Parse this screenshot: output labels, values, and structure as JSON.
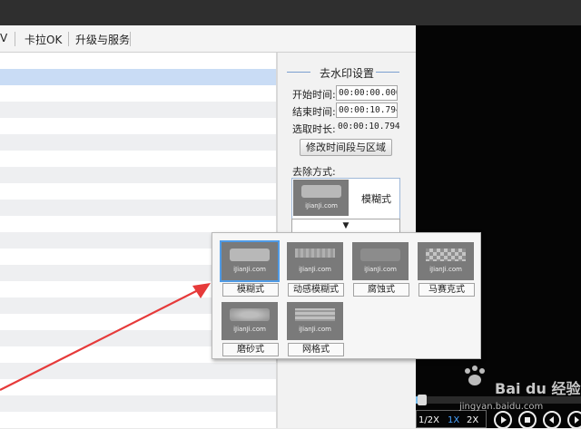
{
  "menu": {
    "items": [
      "V",
      "卡拉OK",
      "升级与服务"
    ]
  },
  "panel": {
    "title": "去水印设置",
    "start_label": "开始时间:",
    "start_value": "00:00:00.000",
    "end_label": "结束时间:",
    "end_value": "00:00:10.794",
    "duration_label": "选取时长:",
    "duration_value": "00:00:10.794",
    "modify_button": "修改时间段与区域",
    "method_label": "去除方式:",
    "selected_method": "模糊式",
    "dropdown_symbol": "▼"
  },
  "popup": {
    "watermark_text": "iJianJi.com",
    "styles": [
      {
        "label": "模糊式",
        "active": true
      },
      {
        "label": "动感模糊式",
        "active": false
      },
      {
        "label": "腐蚀式",
        "active": false
      },
      {
        "label": "马赛克式",
        "active": false
      },
      {
        "label": "磨砂式",
        "active": false
      },
      {
        "label": "网格式",
        "active": false
      }
    ]
  },
  "player": {
    "speeds": [
      "1/2X",
      "1X",
      "2X"
    ],
    "selected_speed": "1X"
  },
  "watermark": {
    "logo_text": "Bai du 经验",
    "url": "jingyan.baidu.com"
  },
  "colors": {
    "accent": "#4f9be6",
    "annotation_arrow": "#e63a3a",
    "selected_row": "#c9dcf5"
  }
}
